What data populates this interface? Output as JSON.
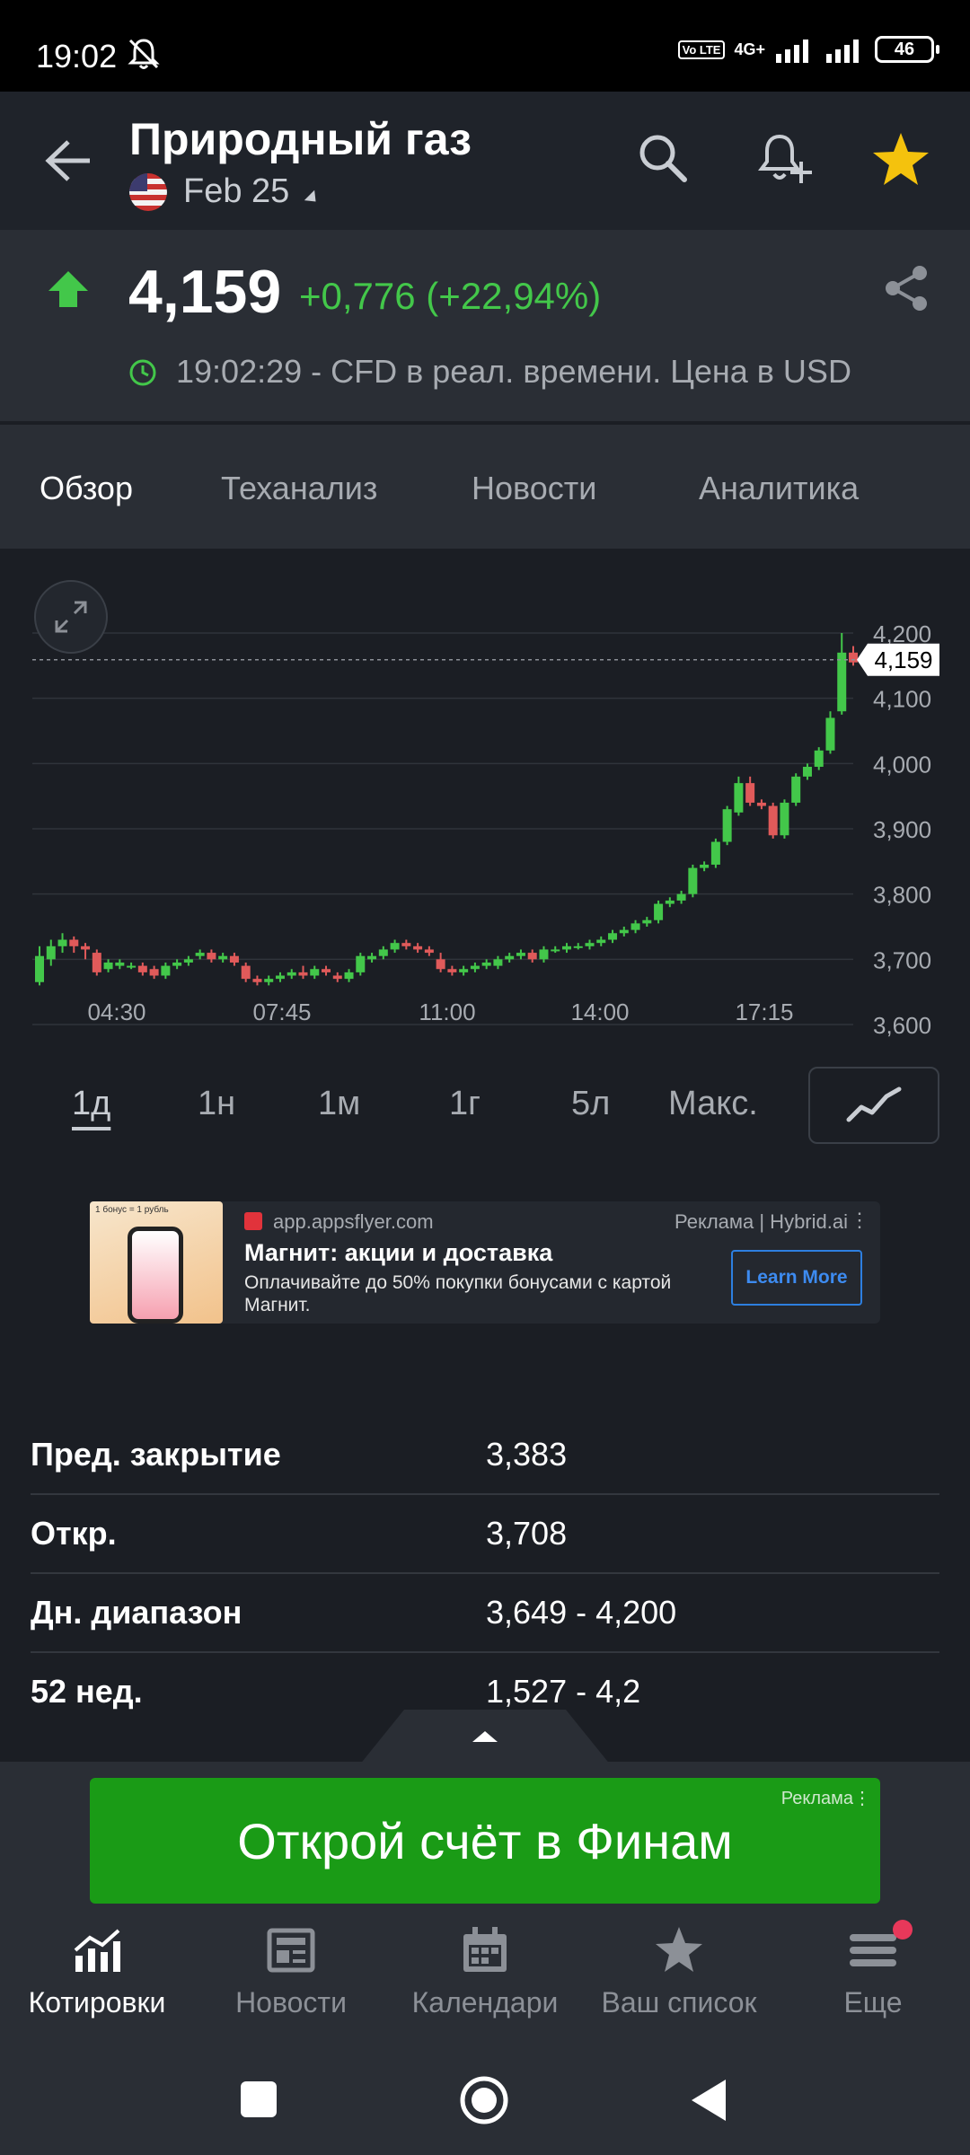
{
  "status_bar": {
    "time": "19:02",
    "net": "4G+",
    "battery": "46",
    "volte": "Vo LTE"
  },
  "header": {
    "title": "Природный газ",
    "contract": "Feb 25"
  },
  "quote": {
    "price": "4,159",
    "change": "+0,776 (+22,94%)",
    "time_note": "19:02:29 - CFD в реал. времени. Цена в USD",
    "direction": "up",
    "up_color": "#43c74a",
    "down_color": "#e05a5a"
  },
  "tabs": [
    "Обзор",
    "Теханализ",
    "Новости",
    "Аналитика"
  ],
  "active_tab": "Обзор",
  "chart_data": {
    "type": "candlestick",
    "current_price_label": "4,159",
    "y_ticks": [
      "4,200",
      "4,100",
      "4,000",
      "3,900",
      "3,800",
      "3,700",
      "3,600"
    ],
    "x_ticks": [
      "04:30",
      "07:45",
      "11:00",
      "14:00",
      "17:15"
    ],
    "ylim": [
      3.6,
      4.2
    ],
    "candles": [
      [
        3.665,
        3.705,
        3.66,
        3.72
      ],
      [
        3.7,
        3.72,
        3.69,
        3.73
      ],
      [
        3.72,
        3.73,
        3.71,
        3.74
      ],
      [
        3.73,
        3.72,
        3.71,
        3.735
      ],
      [
        3.72,
        3.715,
        3.7,
        3.725
      ],
      [
        3.71,
        3.68,
        3.675,
        3.715
      ],
      [
        3.685,
        3.695,
        3.68,
        3.7
      ],
      [
        3.69,
        3.695,
        3.685,
        3.7
      ],
      [
        3.69,
        3.69,
        3.685,
        3.695
      ],
      [
        3.69,
        3.68,
        3.675,
        3.695
      ],
      [
        3.685,
        3.675,
        3.67,
        3.69
      ],
      [
        3.675,
        3.69,
        3.67,
        3.695
      ],
      [
        3.69,
        3.695,
        3.685,
        3.7
      ],
      [
        3.695,
        3.7,
        3.69,
        3.705
      ],
      [
        3.705,
        3.71,
        3.7,
        3.715
      ],
      [
        3.71,
        3.7,
        3.695,
        3.715
      ],
      [
        3.7,
        3.705,
        3.695,
        3.71
      ],
      [
        3.705,
        3.695,
        3.69,
        3.71
      ],
      [
        3.69,
        3.67,
        3.665,
        3.695
      ],
      [
        3.67,
        3.665,
        3.66,
        3.675
      ],
      [
        3.665,
        3.67,
        3.66,
        3.675
      ],
      [
        3.67,
        3.675,
        3.665,
        3.68
      ],
      [
        3.675,
        3.68,
        3.67,
        3.685
      ],
      [
        3.68,
        3.675,
        3.67,
        3.69
      ],
      [
        3.675,
        3.685,
        3.67,
        3.69
      ],
      [
        3.685,
        3.68,
        3.675,
        3.69
      ],
      [
        3.675,
        3.67,
        3.665,
        3.68
      ],
      [
        3.67,
        3.68,
        3.665,
        3.685
      ],
      [
        3.68,
        3.705,
        3.675,
        3.71
      ],
      [
        3.7,
        3.705,
        3.695,
        3.71
      ],
      [
        3.705,
        3.715,
        3.7,
        3.72
      ],
      [
        3.715,
        3.725,
        3.71,
        3.73
      ],
      [
        3.725,
        3.72,
        3.715,
        3.73
      ],
      [
        3.72,
        3.715,
        3.71,
        3.725
      ],
      [
        3.715,
        3.71,
        3.705,
        3.72
      ],
      [
        3.7,
        3.685,
        3.68,
        3.71
      ],
      [
        3.685,
        3.68,
        3.675,
        3.69
      ],
      [
        3.68,
        3.685,
        3.675,
        3.69
      ],
      [
        3.685,
        3.69,
        3.68,
        3.695
      ],
      [
        3.69,
        3.695,
        3.685,
        3.7
      ],
      [
        3.69,
        3.7,
        3.685,
        3.705
      ],
      [
        3.7,
        3.705,
        3.695,
        3.71
      ],
      [
        3.705,
        3.71,
        3.7,
        3.715
      ],
      [
        3.71,
        3.7,
        3.695,
        3.715
      ],
      [
        3.7,
        3.715,
        3.695,
        3.72
      ],
      [
        3.715,
        3.715,
        3.71,
        3.72
      ],
      [
        3.715,
        3.72,
        3.71,
        3.725
      ],
      [
        3.72,
        3.72,
        3.715,
        3.725
      ],
      [
        3.72,
        3.725,
        3.715,
        3.73
      ],
      [
        3.725,
        3.73,
        3.72,
        3.735
      ],
      [
        3.73,
        3.74,
        3.725,
        3.745
      ],
      [
        3.74,
        3.745,
        3.735,
        3.75
      ],
      [
        3.745,
        3.755,
        3.74,
        3.76
      ],
      [
        3.755,
        3.76,
        3.75,
        3.765
      ],
      [
        3.76,
        3.785,
        3.755,
        3.79
      ],
      [
        3.785,
        3.79,
        3.78,
        3.795
      ],
      [
        3.79,
        3.8,
        3.785,
        3.805
      ],
      [
        3.8,
        3.84,
        3.795,
        3.845
      ],
      [
        3.84,
        3.845,
        3.835,
        3.85
      ],
      [
        3.845,
        3.88,
        3.84,
        3.885
      ],
      [
        3.88,
        3.93,
        3.875,
        3.935
      ],
      [
        3.925,
        3.97,
        3.92,
        3.98
      ],
      [
        3.97,
        3.94,
        3.935,
        3.98
      ],
      [
        3.94,
        3.935,
        3.93,
        3.945
      ],
      [
        3.935,
        3.89,
        3.885,
        3.94
      ],
      [
        3.89,
        3.94,
        3.885,
        3.945
      ],
      [
        3.94,
        3.98,
        3.935,
        3.985
      ],
      [
        3.98,
        3.995,
        3.975,
        4.0
      ],
      [
        3.995,
        4.02,
        3.99,
        4.025
      ],
      [
        4.02,
        4.07,
        4.015,
        4.08
      ],
      [
        4.08,
        4.17,
        4.075,
        4.2
      ],
      [
        4.17,
        4.155,
        4.15,
        4.18
      ]
    ]
  },
  "ranges": [
    "1д",
    "1н",
    "1м",
    "1г",
    "5л",
    "Макс."
  ],
  "active_range": "1д",
  "ad_top": {
    "thumb_text": "1 бонус = 1 рубль",
    "source": "app.appsflyer.com",
    "label": "Реклама | Hybrid.ai",
    "title": "Магнит: акции и доставка",
    "desc": "Оплачивайте до 50% покупки бонусами с картой Магнит.",
    "cta": "Learn More"
  },
  "stats": [
    {
      "k": "Пред. закрытие",
      "v": "3,383"
    },
    {
      "k": "Откр.",
      "v": "3,708"
    },
    {
      "k": "Дн. диапазон",
      "v": "3,649 - 4,200"
    },
    {
      "k": "52 нед.",
      "v": "1,527 - 4,2"
    }
  ],
  "ad_bottom": {
    "label": "Реклама",
    "text": "Открой счёт в Финам"
  },
  "bottom_nav": [
    "Котировки",
    "Новости",
    "Календари",
    "Ваш список",
    "Еще"
  ],
  "active_nav": "Котировки"
}
